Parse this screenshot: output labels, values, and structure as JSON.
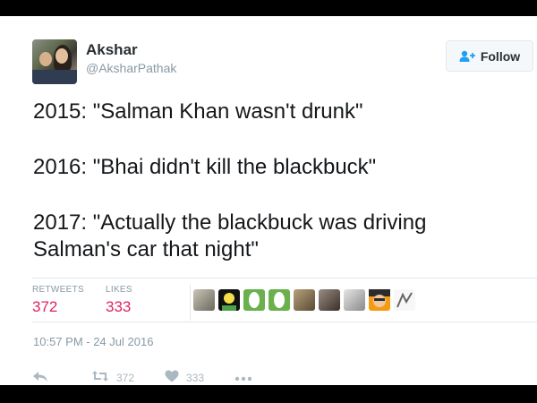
{
  "author": {
    "name": "Akshar",
    "handle": "@AksharPathak"
  },
  "follow_button": {
    "label": "Follow",
    "icon": "add-user-icon"
  },
  "tweet": {
    "lines": [
      "2015: \"Salman Khan wasn't drunk\"",
      "2016: \"Bhai didn't kill the blackbuck\"",
      "2017: \"Actually the blackbuck was driving Salman's car that night\""
    ]
  },
  "stats": {
    "retweets_label": "RETWEETS",
    "retweets_count": "372",
    "likes_label": "LIKES",
    "likes_count": "333"
  },
  "timestamp": "10:57 PM - 24 Jul 2016",
  "actions": {
    "reply_icon": "reply-icon",
    "retweet_icon": "retweet-icon",
    "retweet_count": "372",
    "like_icon": "heart-icon",
    "like_count": "333",
    "more_icon": "more-icon"
  },
  "colors": {
    "stat_value": "#e0245e",
    "muted": "#8899a6",
    "text": "#14171a"
  }
}
